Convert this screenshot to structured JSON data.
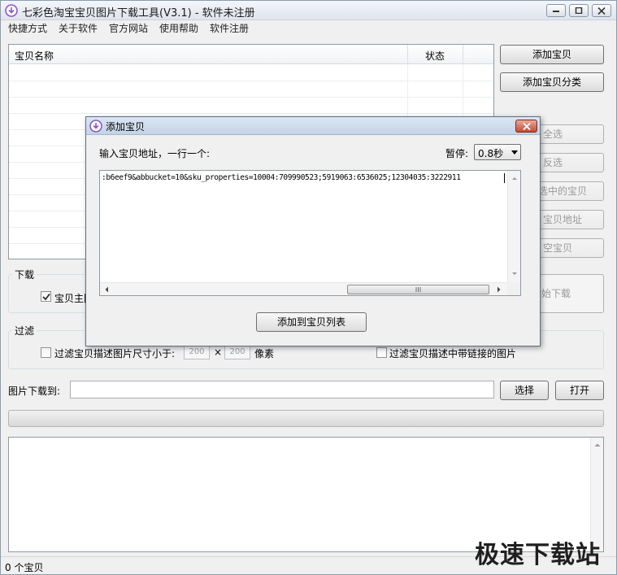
{
  "window": {
    "title": "七彩色淘宝宝贝图片下载工具(V3.1) - 软件未注册"
  },
  "menu": [
    "快捷方式",
    "关于软件",
    "官方网站",
    "使用帮助",
    "软件注册"
  ],
  "list": {
    "columns": {
      "name": "宝贝名称",
      "status": "状态"
    }
  },
  "side_buttons": {
    "add_item": "添加宝贝",
    "add_category": "添加宝贝分类",
    "select_all": "全选",
    "invert": "反选",
    "delete_selected": "选中的宝贝",
    "copy_url": "宝贝地址",
    "clear": "空宝贝",
    "start_download": "始下载"
  },
  "download_group": {
    "label": "下载",
    "main_image_checkbox": "宝贝主图",
    "main_image_checked": true
  },
  "filter_group": {
    "label": "过滤",
    "size_filter_label": "过滤宝贝描述图片尺寸小于:",
    "width": "200",
    "times": "×",
    "height": "200",
    "unit": "像素",
    "link_filter_label": "过滤宝贝描述中带链接的图片"
  },
  "save_path": {
    "label": "图片下载到:",
    "value": "",
    "choose": "选择",
    "open": "打开"
  },
  "status": {
    "count": "0 个宝贝"
  },
  "watermark": "极速下载站",
  "dialog": {
    "title": "添加宝贝",
    "prompt": "输入宝贝地址，一行一个:",
    "pause_label": "暂停:",
    "pause_value": "0.8秒",
    "text": ":b6eef9&abbucket=10&sku_properties=10004:709990523;5919063:6536025;12304035:3222911",
    "submit": "添加到宝贝列表"
  },
  "colors": {
    "app_icon": "#8c56c9",
    "close_button": "#c54a31"
  }
}
